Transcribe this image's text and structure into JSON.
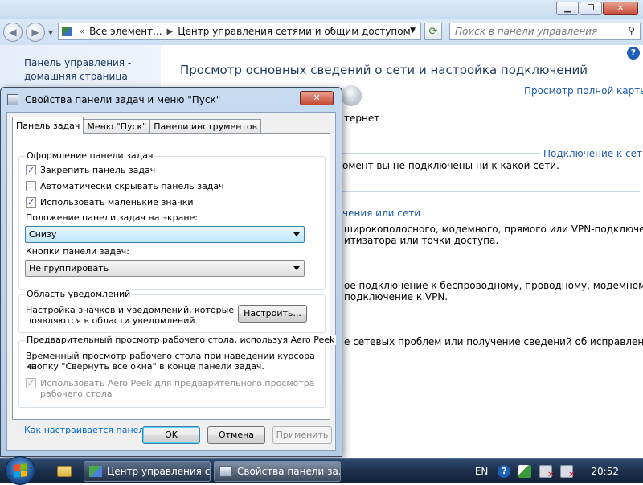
{
  "window": {
    "address": {
      "crumb1": "Все элемент...",
      "crumb2": "Центр управления сетями и общим доступом"
    },
    "search_placeholder": "Поиск в панели управления",
    "left_pane": {
      "home_line1": "Панель управления -",
      "home_line2": "домашняя страница"
    },
    "main": {
      "title": "Просмотр основных сведений о сети и настройка подключений",
      "full_map_link": "Просмотр полной карты",
      "internet_label": "тернет",
      "connect_link": "Подключение к сети",
      "not_connected": "омент вы не подключены ни к какой сети.",
      "setup_link": "чения или сети",
      "setup_desc1": "широкополосного, модемного, прямого или VPN-подключения",
      "setup_desc2": "итизатора или точки доступа.",
      "connect_desc1": "ое подключение к беспроводному, проводному, модемному",
      "connect_desc2": "подключение к VPN.",
      "troubleshoot_desc": "е сетевых проблем или получение сведений об исправлении."
    }
  },
  "dialog": {
    "title": "Свойства панели задач и меню \"Пуск\"",
    "close_label": "✕",
    "tabs": [
      "Панель задач",
      "Меню \"Пуск\"",
      "Панели инструментов"
    ],
    "group_appearance": {
      "legend": "Оформление панели задач",
      "lock_label": "Закрепить панель задач",
      "lock_checked": true,
      "autohide_label": "Автоматически скрывать панель задач",
      "autohide_checked": false,
      "small_icons_label": "Использовать маленькие значки",
      "small_icons_checked": true,
      "position_label": "Положение панели задач на экране:",
      "position_value": "Снизу",
      "buttons_label": "Кнопки панели задач:",
      "buttons_value": "Не группировать"
    },
    "group_notify": {
      "legend": "Область уведомлений",
      "desc_line1": "Настройка значков и уведомлений, которые",
      "desc_line2": "появляются в области уведомлений.",
      "customize_label": "Настроить..."
    },
    "group_peek": {
      "legend": "Предварительный просмотр рабочего стола, используя Aero Peek",
      "desc_line1": "Временный просмотр рабочего стола при наведении курсора на",
      "desc_line2": "кнопку \"Свернуть все окна\" в конце панели задач.",
      "peek_label_line1": "Использовать Aero Peek для предварительного просмотра",
      "peek_label_line2": "рабочего стола",
      "peek_checked": true,
      "peek_disabled": true
    },
    "help_link": "Как настраивается панель задач?",
    "buttons": {
      "ok": "OK",
      "cancel": "Отмена",
      "apply": "Применить"
    }
  },
  "taskbar": {
    "buttons": [
      {
        "label": "Центр управления с...",
        "active": false
      },
      {
        "label": "Свойства панели за...",
        "active": true
      }
    ],
    "language": "EN",
    "clock": "20:52"
  },
  "colors": {
    "link": "#1c5aa9",
    "dialog_frame": "#b5cde8",
    "taskbar": "#1b2f4b",
    "close_red": "#c54935"
  }
}
